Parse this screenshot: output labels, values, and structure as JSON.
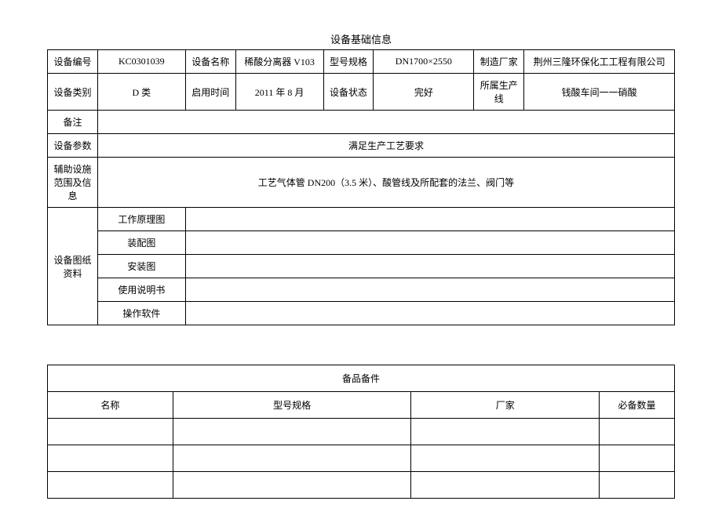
{
  "table1": {
    "title": "设备基础信息",
    "row1": {
      "label_id": "设备编号",
      "value_id": "KC0301039",
      "label_name": "设备名称",
      "value_name": "稀酸分离器 V103",
      "label_model": "型号规格",
      "value_model": "DN1700×2550",
      "label_maker": "制造厂家",
      "value_maker": "荆州三隆环保化工工程有限公司"
    },
    "row2": {
      "label_category": "设备类别",
      "value_category": "D 类",
      "label_starttime": "启用时间",
      "value_starttime": "2011 年 8 月",
      "label_status": "设备状态",
      "value_status": "完好",
      "label_line": "所属生产线",
      "value_line": "钱酸车间一一硝酸"
    },
    "row3": {
      "label_remark": "备注",
      "value_remark": ""
    },
    "row4": {
      "label_param": "设备参数",
      "value_param": "满足生产工艺要求"
    },
    "row5": {
      "label_aux": "辅助设施范围及信息",
      "value_aux": "工艺气体管 DN200（3.5 米）、酸管线及所配套的法兰、阀门等"
    },
    "drawings": {
      "group_label": "设备图纸资料",
      "items": [
        "工作原理图",
        "装配图",
        "安装图",
        "使用说明书",
        "操作软件"
      ]
    }
  },
  "table2": {
    "title": "备品备件",
    "headers": {
      "name": "名称",
      "model": "型号规格",
      "maker": "厂家",
      "qty": "必备数量"
    },
    "rows": [
      {
        "name": "",
        "model": "",
        "maker": "",
        "qty": ""
      },
      {
        "name": "",
        "model": "",
        "maker": "",
        "qty": ""
      },
      {
        "name": "",
        "model": "",
        "maker": "",
        "qty": ""
      }
    ]
  }
}
